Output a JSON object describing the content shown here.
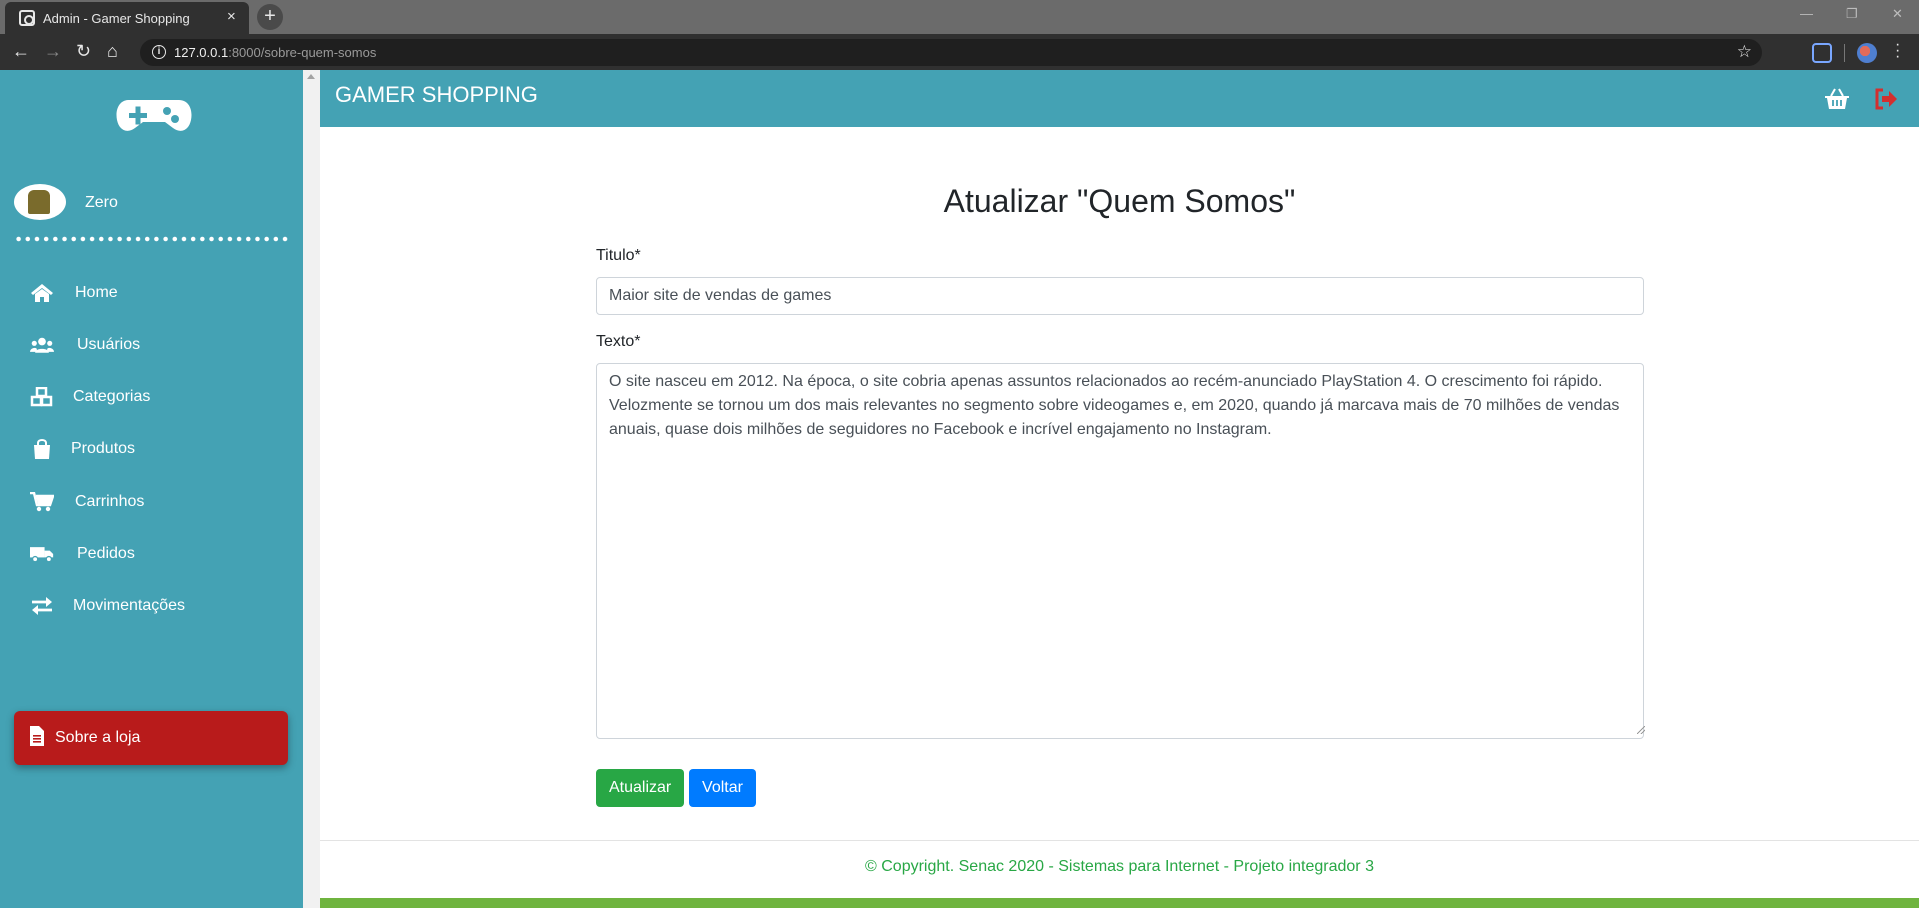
{
  "browser": {
    "tab_title": "Admin - Gamer Shopping",
    "close_glyph": "×",
    "new_tab_glyph": "+",
    "url_host": "127.0.0.1",
    "url_rest": ":8000/sobre-quem-somos",
    "window_controls": [
      "—",
      "❐",
      "✕"
    ]
  },
  "sidebar": {
    "logo": "gamepad-icon",
    "user_name": "Zero",
    "items": [
      {
        "label": "Home",
        "icon": "home-icon"
      },
      {
        "label": "Usuários",
        "icon": "users-icon"
      },
      {
        "label": "Categorias",
        "icon": "cubes-icon"
      },
      {
        "label": "Produtos",
        "icon": "shopping-bag-icon"
      },
      {
        "label": "Carrinhos",
        "icon": "cart-icon"
      },
      {
        "label": "Pedidos",
        "icon": "truck-icon"
      },
      {
        "label": "Movimentações",
        "icon": "exchange-icon"
      },
      {
        "label": "Sobre a loja",
        "icon": "file-icon",
        "active": true
      }
    ]
  },
  "header": {
    "brand": "GAMER SHOPPING"
  },
  "form": {
    "page_title": "Atualizar \"Quem Somos\"",
    "title_label": "Titulo*",
    "title_value": "Maior site de vendas de games",
    "text_label": "Texto*",
    "text_value": "O site nasceu em 2012. Na época, o site cobria apenas assuntos relacionados ao recém-anunciado PlayStation 4. O crescimento foi rápido. Velozmente se tornou um dos mais relevantes no segmento sobre videogames e, em 2020, quando já marcava mais de 70 milhões de vendas anuais, quase dois milhões de seguidores no Facebook e incrível engajamento no Instagram.",
    "submit_label": "Atualizar",
    "back_label": "Voltar"
  },
  "footer": {
    "text": "© Copyright. Senac 2020 - Sistemas para Internet - Projeto integrador 3"
  },
  "colors": {
    "sidebar": "#44a2b4",
    "active_item": "#b81b1b",
    "success": "#28a745",
    "primary": "#007bff",
    "footer_bar": "#6fb43f"
  }
}
